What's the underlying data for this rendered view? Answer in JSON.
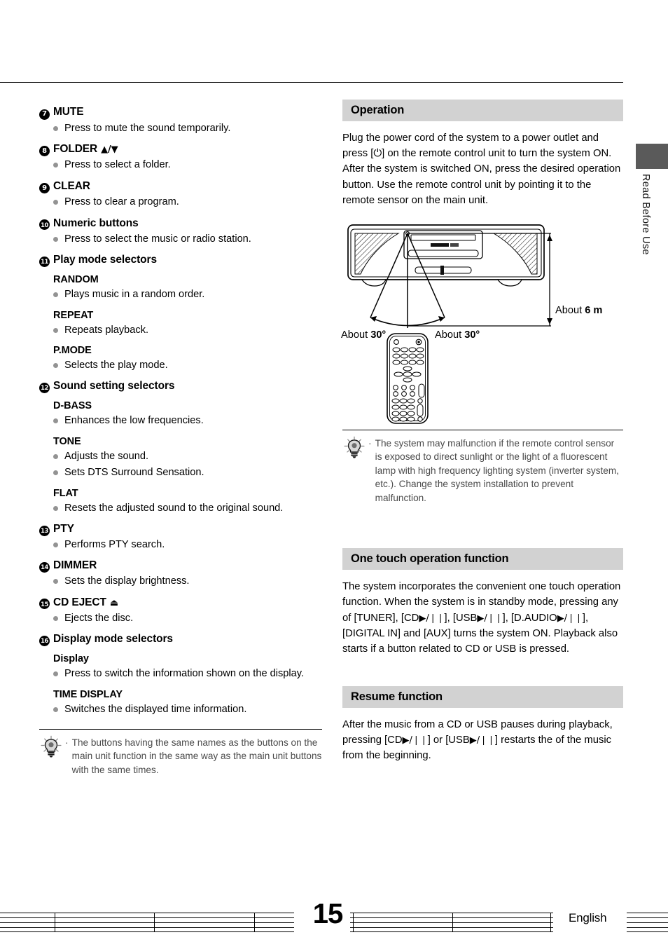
{
  "page": {
    "number": "15",
    "language": "English",
    "side_tab": "Read Before Use"
  },
  "left_column": {
    "entries": [
      {
        "number": "7",
        "title": "MUTE",
        "glyph": "",
        "bullets": [
          "Press to mute the sound temporarily."
        ],
        "subsections": []
      },
      {
        "number": "8",
        "title": "FOLDER",
        "glyph": "▲/▼",
        "bullets": [
          "Press to select a folder."
        ],
        "subsections": []
      },
      {
        "number": "9",
        "title": "CLEAR",
        "glyph": "",
        "bullets": [
          "Press to clear a program."
        ],
        "subsections": []
      },
      {
        "number": "10",
        "title": "Numeric buttons",
        "glyph": "",
        "bullets": [
          "Press to select the music or radio station."
        ],
        "subsections": []
      },
      {
        "number": "11",
        "title": "Play mode selectors",
        "glyph": "",
        "bullets": [],
        "subsections": [
          {
            "label": "RANDOM",
            "bullets": [
              "Plays music in a random order."
            ]
          },
          {
            "label": "REPEAT",
            "bullets": [
              "Repeats playback."
            ]
          },
          {
            "label": "P.MODE",
            "bullets": [
              "Selects the play mode."
            ]
          }
        ]
      },
      {
        "number": "12",
        "title": "Sound setting selectors",
        "glyph": "",
        "bullets": [],
        "subsections": [
          {
            "label": "D-BASS",
            "bullets": [
              "Enhances the low frequencies."
            ]
          },
          {
            "label": "TONE",
            "bullets": [
              "Adjusts the sound.",
              "Sets DTS Surround Sensation."
            ]
          },
          {
            "label": "FLAT",
            "bullets": [
              "Resets the adjusted sound to the original sound."
            ]
          }
        ]
      },
      {
        "number": "13",
        "title": "PTY",
        "glyph": "",
        "bullets": [
          "Performs PTY search."
        ],
        "subsections": []
      },
      {
        "number": "14",
        "title": "DIMMER",
        "glyph": "",
        "bullets": [
          "Sets the display brightness."
        ],
        "subsections": []
      },
      {
        "number": "15",
        "title": "CD EJECT",
        "glyph": "⏏",
        "bullets": [
          "Ejects the disc."
        ],
        "subsections": []
      },
      {
        "number": "16",
        "title": "Display mode selectors",
        "glyph": "",
        "bullets": [],
        "subsections": [
          {
            "label": "Display",
            "bullets": [
              "Press to switch the information shown on the display."
            ]
          },
          {
            "label": "TIME DISPLAY",
            "bullets": [
              "Switches the displayed time information."
            ]
          }
        ]
      }
    ],
    "note": {
      "marker": "·",
      "text": "The buttons having the same names as the buttons on the main unit function in the same way as the main unit buttons with the same times."
    }
  },
  "right_column": {
    "operation": {
      "heading": "Operation",
      "body": "Plug the power cord of the system to a power outlet and press [⏻] on the remote control unit to turn the system ON. After the system is switched ON, press the desired operation button. Use the remote control unit by pointing it to the remote sensor on the main unit."
    },
    "diagram": {
      "distance_prefix": "About ",
      "distance_value": "6 m",
      "angle_left_prefix": "About ",
      "angle_left_value": "30°",
      "angle_right_prefix": "About ",
      "angle_right_value": "30°"
    },
    "note": {
      "marker": "·",
      "text": "The system may malfunction if the remote control sensor is exposed to direct sunlight or the light of a fluorescent lamp with high frequency lighting system (inverter system, etc.). Change the system installation to prevent malfunction."
    },
    "one_touch": {
      "heading": "One touch operation function",
      "body_part1": "The system incorporates the convenient one touch operation function. When the system is in standby mode, pressing any of [TUNER], [CD",
      "play_pause": "▶/❘❘",
      "body_part2": "], [USB",
      "body_part3": "], [D.AUDIO",
      "body_part4": "], [DIGITAL IN] and [AUX] turns the system ON. Playback also starts if a button related to CD or USB is pressed."
    },
    "resume": {
      "heading": "Resume function",
      "body_part1": "After the music from a CD or USB pauses during playback, pressing [CD",
      "play_pause": "▶/❘❘",
      "body_part2": "] or [USB",
      "body_part3": "] restarts the of the music from the beginning."
    }
  }
}
